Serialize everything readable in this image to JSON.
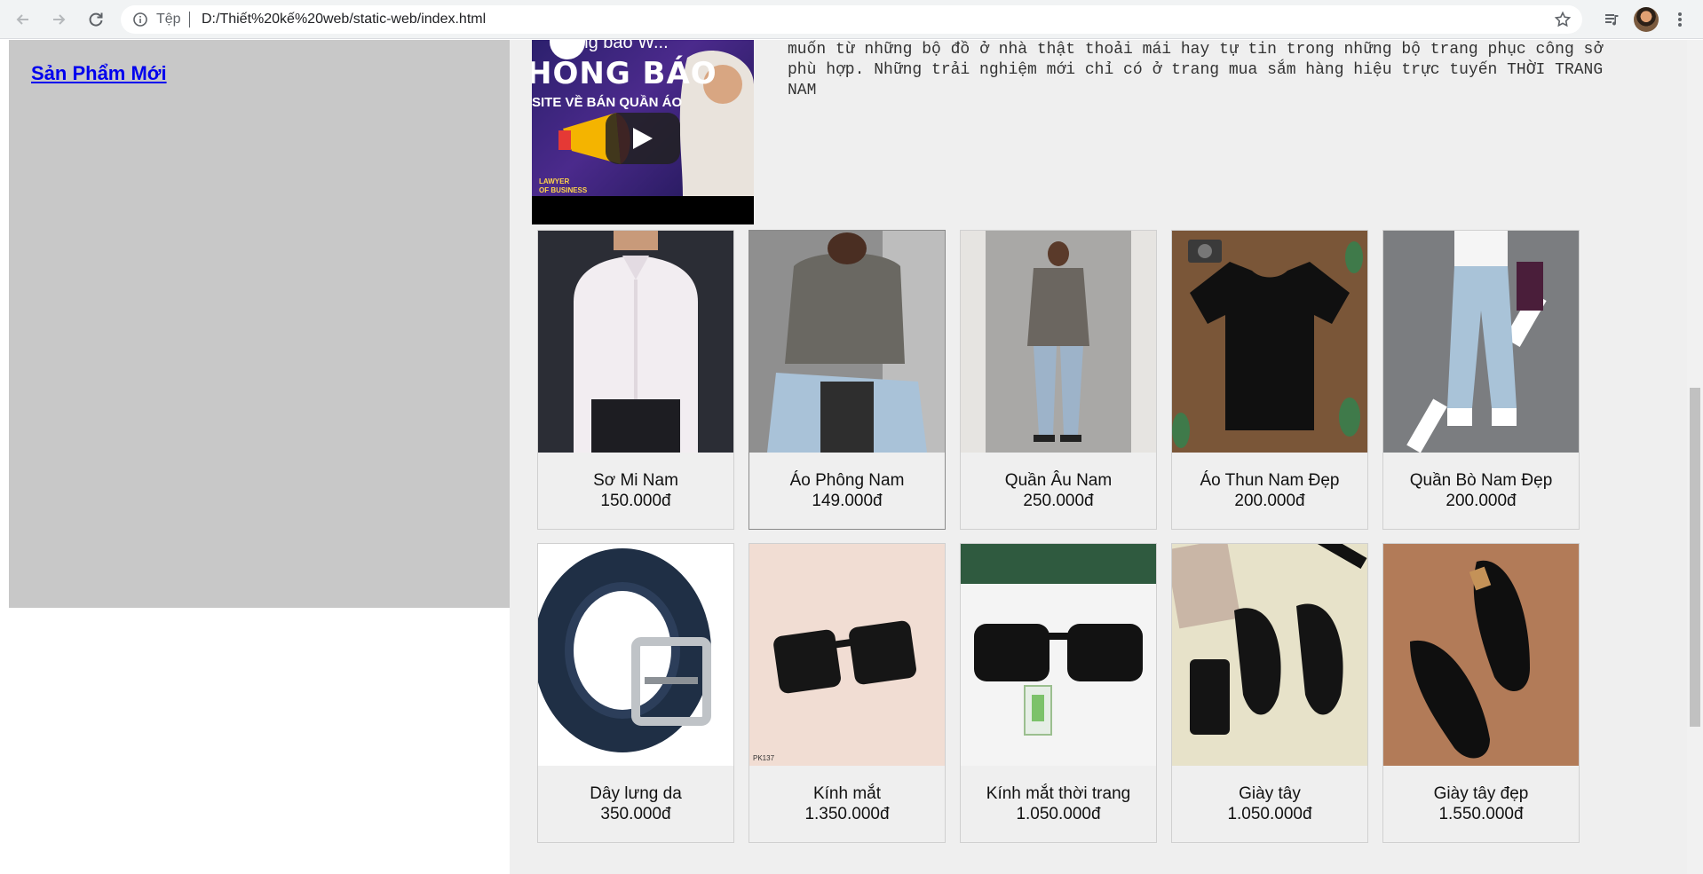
{
  "browser": {
    "address_label": "Tệp",
    "url": "D:/Thiết%20kế%20web/static-web/index.html",
    "icons": [
      "back-arrow-icon",
      "forward-arrow-icon",
      "reload-icon",
      "info-icon",
      "star-icon",
      "media-playlist-icon",
      "avatar",
      "kebab-menu-icon"
    ]
  },
  "sidebar": {
    "link_label": "Sản Phẩm Mới",
    "background": "#c8c8c8"
  },
  "video": {
    "poster_title": "Thông báo W...",
    "poster_heading": "HONG BÁO",
    "poster_subtitle": "SITE VỀ BÁN QUẦN ÁO",
    "poster_footer": "LAWYER OF BUSINESS"
  },
  "intro": {
    "text": "muốn từ những bộ đồ ở nhà thật thoải mái hay tự tin trong những bộ trang phục công sở phù hợp. Những trải nghiệm mới chỉ có ở trang mua sắm hàng hiệu trực tuyến THỜI TRANG NAM"
  },
  "products": [
    {
      "name": "Sơ Mi Nam",
      "price": "150.000đ"
    },
    {
      "name": "Áo Phông Nam",
      "price": "149.000đ"
    },
    {
      "name": "Quần Âu Nam",
      "price": "250.000đ"
    },
    {
      "name": "Áo Thun Nam Đẹp",
      "price": "200.000đ"
    },
    {
      "name": "Quần Bò Nam Đẹp",
      "price": "200.000đ"
    },
    {
      "name": "Dây lưng da",
      "price": "350.000đ"
    },
    {
      "name": "Kính mắt",
      "price": "1.350.000đ"
    },
    {
      "name": "Kính mắt thời trang",
      "price": "1.050.000đ"
    },
    {
      "name": "Giày tây",
      "price": "1.050.000đ"
    },
    {
      "name": "Giày tây đẹp",
      "price": "1.550.000đ"
    }
  ],
  "colors": {
    "link": "#0000ee",
    "content_bg": "#efefef"
  }
}
